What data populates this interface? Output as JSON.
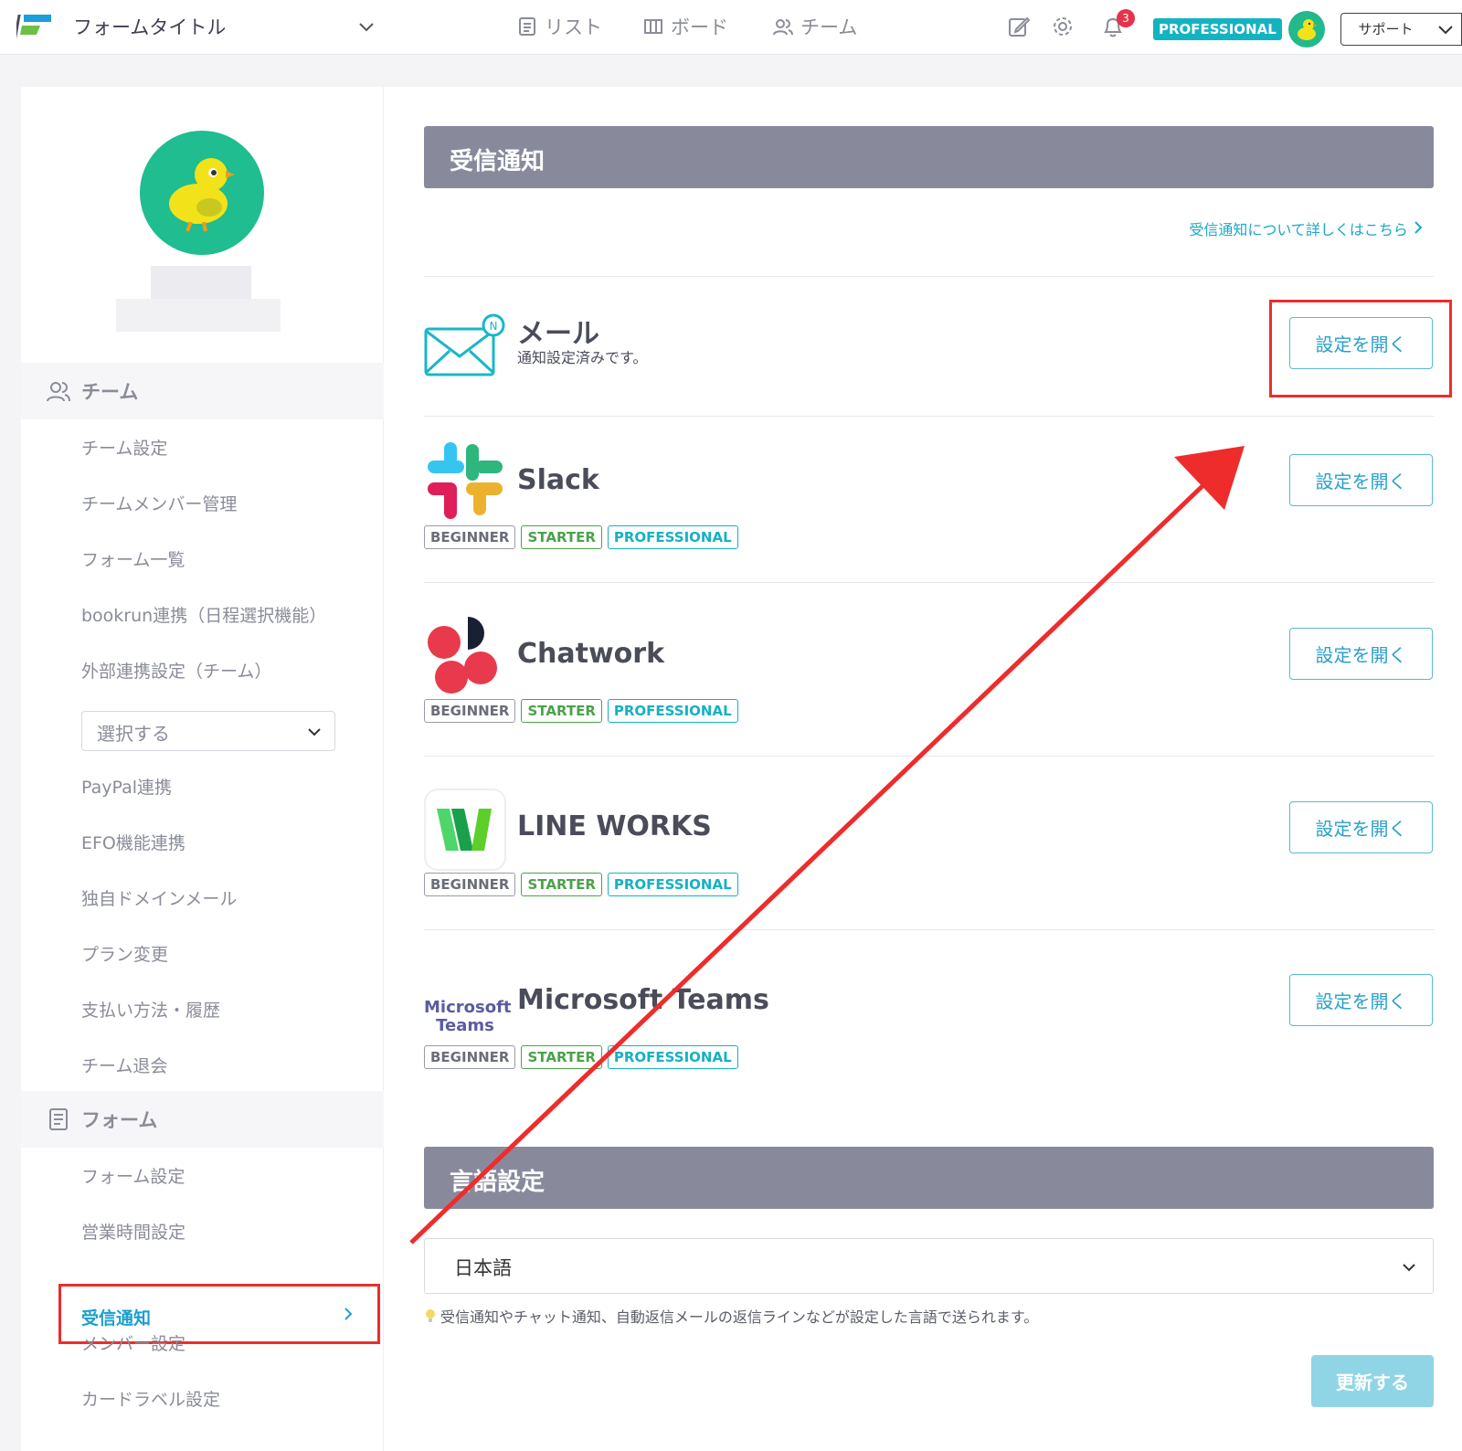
{
  "header": {
    "form_title": "フォームタイトル",
    "nav": {
      "list": "リスト",
      "board": "ボード",
      "team": "チーム"
    },
    "notification_count": "3",
    "plan_badge": "PROFESSIONAL",
    "support_label": "サポート"
  },
  "sidebar": {
    "team_section": "チーム",
    "team_items": [
      "チーム設定",
      "チームメンバー管理",
      "フォーム一覧",
      "bookrun連携（日程選択機能）",
      "外部連携設定（チーム）"
    ],
    "external_select": "選択する",
    "team_items2": [
      "PayPal連携",
      "EFO機能連携",
      "独自ドメインメール",
      "プラン変更",
      "支払い方法・履歴",
      "チーム退会"
    ],
    "form_section": "フォーム",
    "form_items": [
      "フォーム設定",
      "営業時間設定"
    ],
    "active_item": "受信通知",
    "form_items2": [
      "メンバー設定",
      "カードラベル設定"
    ]
  },
  "main": {
    "section_title": "受信通知",
    "help_link": "受信通知について詳しくはこちら",
    "services": [
      {
        "name": "メール",
        "sub": "通知設定済みです。",
        "button": "設定を開く"
      },
      {
        "name": "Slack",
        "button": "設定を開く"
      },
      {
        "name": "Chatwork",
        "button": "設定を開く"
      },
      {
        "name": "LINE WORKS",
        "button": "設定を開く"
      },
      {
        "name": "Microsoft Teams",
        "button": "設定を開く",
        "logo_text1": "Microsoft",
        "logo_text2": "Teams"
      }
    ],
    "plan_tags": {
      "beginner": "BEGINNER",
      "starter": "STARTER",
      "professional": "PROFESSIONAL"
    },
    "language_title": "言語設定",
    "language_value": "日本語",
    "language_note": "受信通知やチャット通知、自動返信メールの返信ラインなどが設定した言語で送られます。",
    "update_button": "更新する"
  },
  "colors": {
    "accent": "#14b3c2",
    "annotation_red": "#ee2c2c",
    "section_bar": "#888a9c"
  }
}
